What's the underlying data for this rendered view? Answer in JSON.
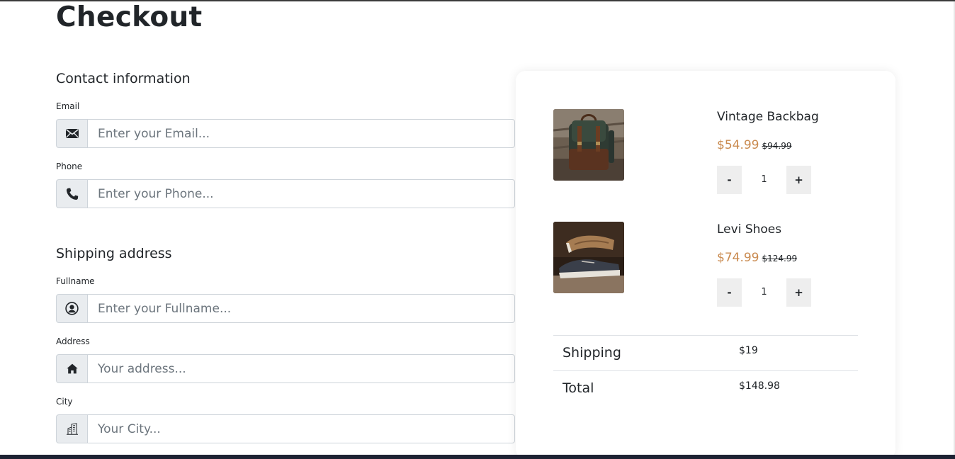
{
  "page": {
    "title": "Checkout"
  },
  "contact": {
    "heading": "Contact information",
    "email": {
      "label": "Email",
      "placeholder": "Enter your Email...",
      "value": "",
      "icon": "envelope-icon"
    },
    "phone": {
      "label": "Phone",
      "placeholder": "Enter your Phone...",
      "value": "",
      "icon": "phone-icon"
    }
  },
  "shipping": {
    "heading": "Shipping address",
    "fullname": {
      "label": "Fullname",
      "placeholder": "Enter your Fullname...",
      "value": "",
      "icon": "user-circle-icon"
    },
    "address": {
      "label": "Address",
      "placeholder": "Your address...",
      "value": "",
      "icon": "home-icon"
    },
    "city": {
      "label": "City",
      "placeholder": "Your City...",
      "value": "",
      "icon": "building-icon"
    }
  },
  "cart": {
    "items": [
      {
        "name": "Vintage Backbag",
        "price": "$54.99",
        "old_price": "$94.99",
        "quantity": "1",
        "decrement_label": "-",
        "increment_label": "+",
        "image": "backpack-photo"
      },
      {
        "name": "Levi Shoes",
        "price": "$74.99",
        "old_price": "$124.99",
        "quantity": "1",
        "decrement_label": "-",
        "increment_label": "+",
        "image": "shoes-photo"
      }
    ],
    "shipping_label": "Shipping",
    "shipping_value": "$19",
    "total_label": "Total",
    "total_value": "$148.98"
  },
  "colors": {
    "price_accent": "#c98a4f",
    "addon_background": "#e9ecef",
    "border": "#ced4da",
    "bottom_bar": "#1e2233"
  }
}
